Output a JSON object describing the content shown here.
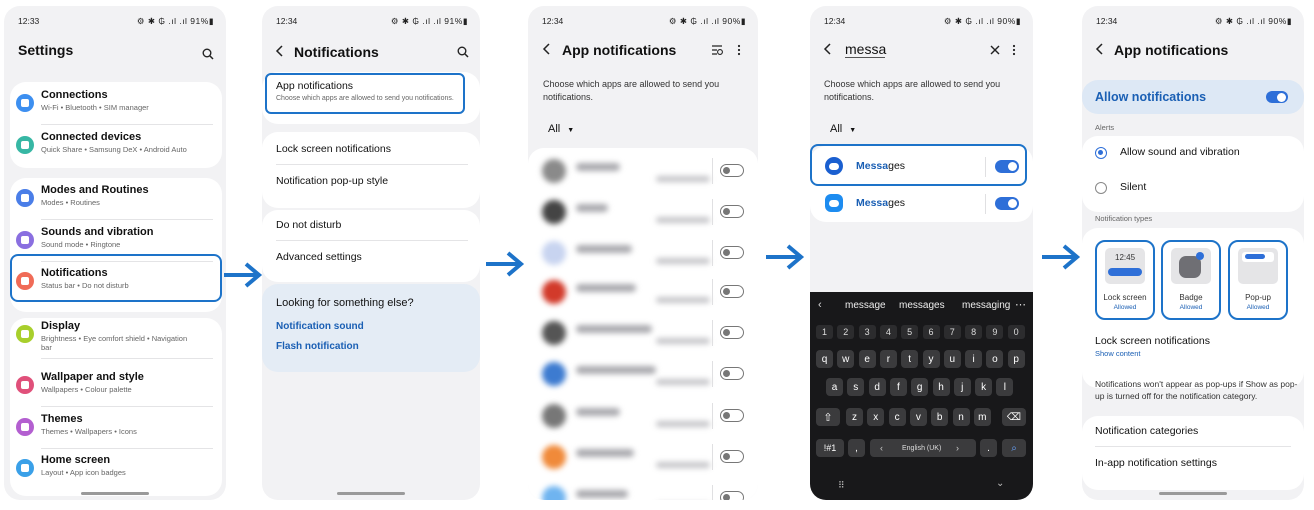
{
  "colors": {
    "accent": "#1d73c9",
    "toggle_on": "#2e6fd8",
    "link": "#1a5fb4"
  },
  "screen1": {
    "status_time": "12:33",
    "status_right": "⚙ ✱ ₲ .ıl .ıl 91%▮",
    "title": "Settings",
    "items": [
      {
        "title": "Connections",
        "subtitle": "Wi-Fi • Bluetooth • SIM manager",
        "icon": "wifi-icon",
        "color": "#3d8ff0"
      },
      {
        "title": "Connected devices",
        "subtitle": "Quick Share • Samsung DeX • Android Auto",
        "icon": "devices-icon",
        "color": "#37b7a4"
      },
      {
        "title": "Modes and Routines",
        "subtitle": "Modes • Routines",
        "icon": "modes-icon",
        "color": "#4a7ee8"
      },
      {
        "title": "Sounds and vibration",
        "subtitle": "Sound mode • Ringtone",
        "icon": "sound-icon",
        "color": "#8a6fe0"
      },
      {
        "title": "Notifications",
        "subtitle": "Status bar • Do not disturb",
        "icon": "notification-icon",
        "color": "#f06b57"
      },
      {
        "title": "Display",
        "subtitle": "Brightness • Eye comfort shield • Navigation",
        "subtitle2": "bar",
        "icon": "display-icon",
        "color": "#a8cf2c"
      },
      {
        "title": "Wallpaper and style",
        "subtitle": "Wallpapers • Colour palette",
        "icon": "wallpaper-icon",
        "color": "#e0507a"
      },
      {
        "title": "Themes",
        "subtitle": "Themes • Wallpapers • Icons",
        "icon": "themes-icon",
        "color": "#b35fd0"
      },
      {
        "title": "Home screen",
        "subtitle": "Layout • App icon badges",
        "icon": "home-icon",
        "color": "#3aa0e8"
      }
    ]
  },
  "screen2": {
    "status_time": "12:34",
    "status_right": "⚙ ✱ ₲ .ıl .ıl 91%▮",
    "title": "Notifications",
    "app_notifications": "App notifications",
    "app_notifications_sub": "Choose which apps are allowed to send you notifications.",
    "lock_screen": "Lock screen notifications",
    "popup_style": "Notification pop-up style",
    "dnd": "Do not disturb",
    "advanced": "Advanced settings",
    "looking": "Looking for something else?",
    "link1": "Notification sound",
    "link2": "Flash notification"
  },
  "screen3": {
    "status_time": "12:34",
    "status_right": "⚙ ✱ ₲ .ıl .ıl 90%▮",
    "title": "App notifications",
    "description": "Choose which apps are allowed to send you notifications.",
    "filter": "All"
  },
  "screen4": {
    "status_time": "12:34",
    "status_right": "⚙ ✱ ₲ .ıl .ıl 90%▮",
    "search_value": "messa",
    "description": "Choose which apps are allowed to send you notifications.",
    "filter": "All",
    "results": [
      {
        "match": "Messa",
        "rest": "ges"
      },
      {
        "match": "Messa",
        "rest": "ges"
      }
    ],
    "suggestions": [
      "message",
      "messages",
      "messaging"
    ],
    "number_row": [
      "1",
      "2",
      "3",
      "4",
      "5",
      "6",
      "7",
      "8",
      "9",
      "0"
    ],
    "row1": [
      "q",
      "w",
      "e",
      "r",
      "t",
      "y",
      "u",
      "i",
      "o",
      "p"
    ],
    "row2": [
      "a",
      "s",
      "d",
      "f",
      "g",
      "h",
      "j",
      "k",
      "l"
    ],
    "row3": [
      "z",
      "x",
      "c",
      "v",
      "b",
      "n",
      "m"
    ],
    "sym_key": "!#1",
    "comma_key": ",",
    "language": "English (UK)",
    "period_key": "."
  },
  "screen5": {
    "status_time": "12:34",
    "status_right": "⚙ ✱ ₲ .ıl .ıl 90%▮",
    "title": "App notifications",
    "allow": "Allow notifications",
    "alerts_header": "Alerts",
    "option1": "Allow sound and vibration",
    "option2": "Silent",
    "types_header": "Notification types",
    "lock_time": "12:45",
    "types": [
      {
        "label": "Lock screen",
        "status": "Allowed"
      },
      {
        "label": "Badge",
        "status": "Allowed"
      },
      {
        "label": "Pop-up",
        "status": "Allowed"
      }
    ],
    "lock_notif": "Lock screen notifications",
    "show_content": "Show content",
    "info": "Notifications won't appear as pop-ups if Show as pop-up is turned off for the notification category.",
    "categories": "Notification categories",
    "inapp": "In-app notification settings"
  }
}
